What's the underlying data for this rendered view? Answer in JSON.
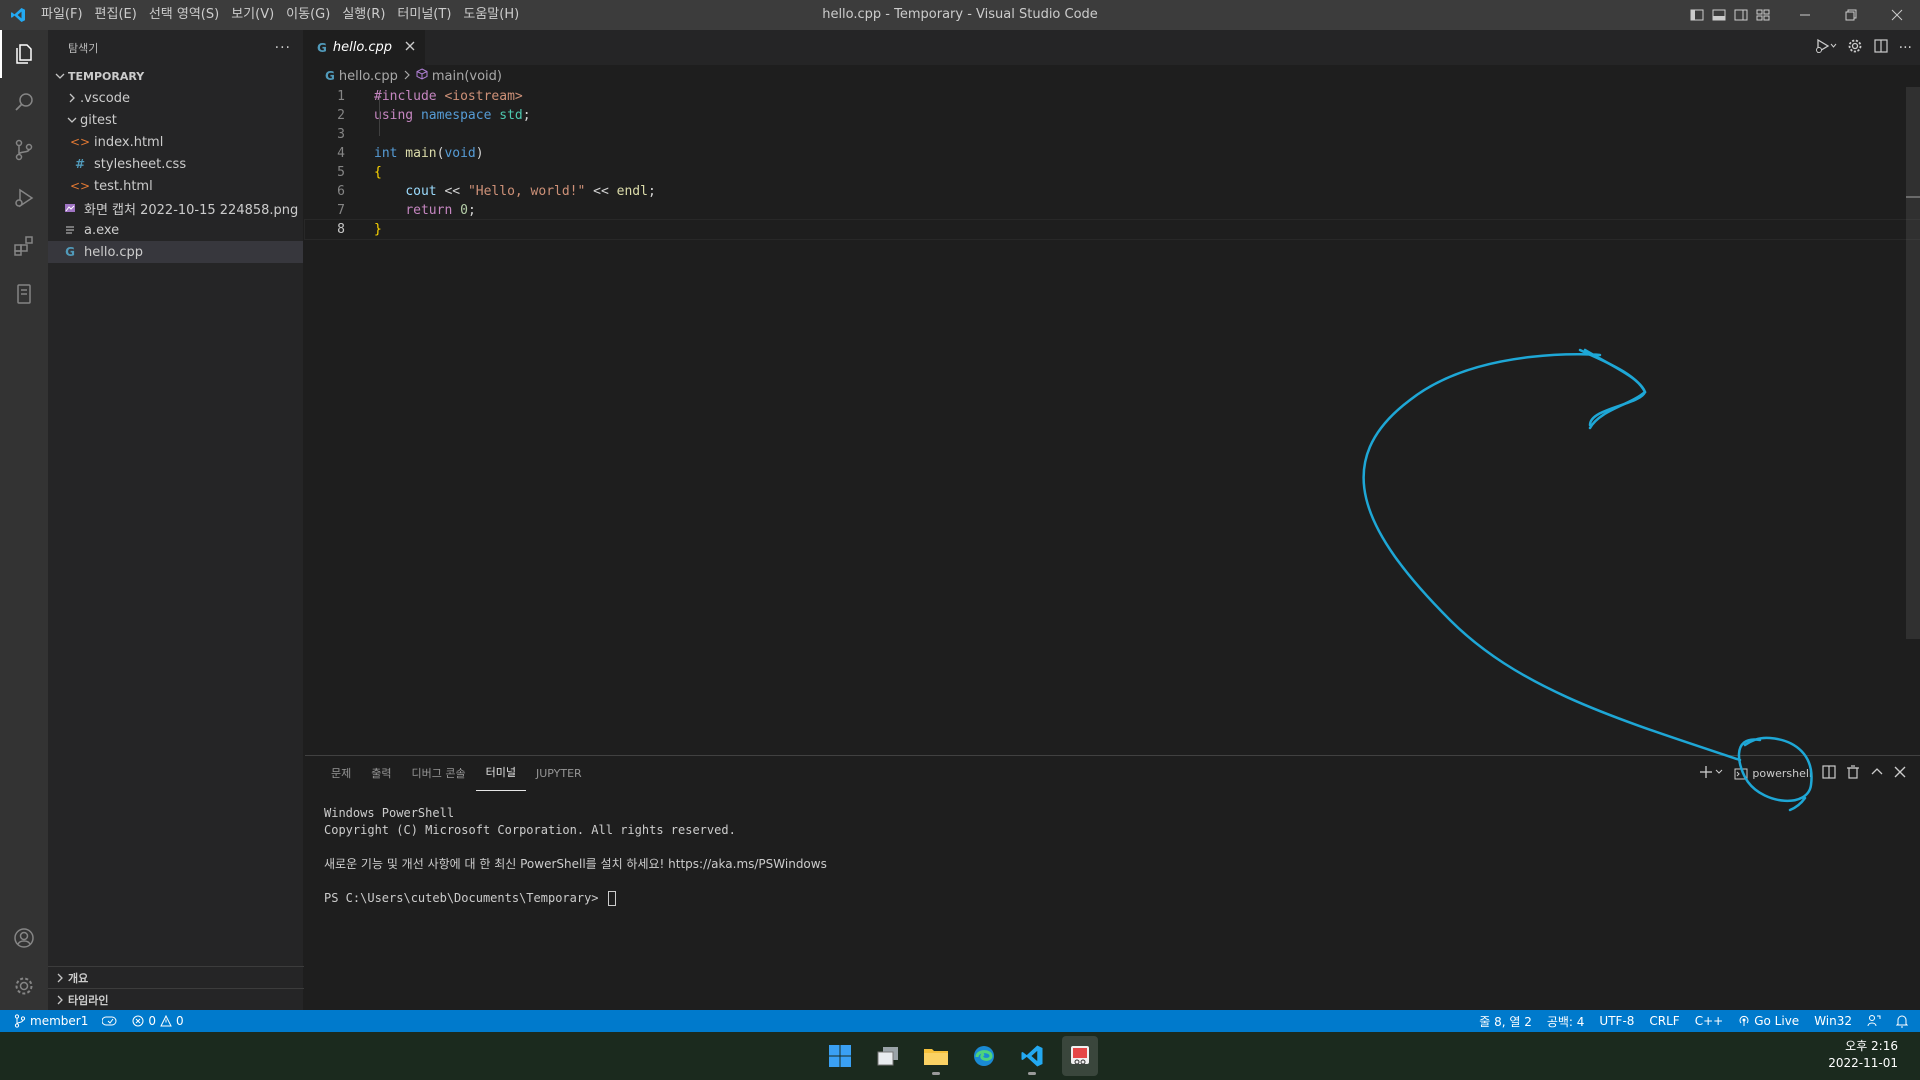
{
  "titlebar": {
    "title": "hello.cpp - Temporary - Visual Studio Code",
    "menu": [
      "파일(F)",
      "편집(E)",
      "선택 영역(S)",
      "보기(V)",
      "이동(G)",
      "실행(R)",
      "터미널(T)",
      "도움말(H)"
    ]
  },
  "sidebar": {
    "title": "탐색기",
    "more": "···",
    "folder": "TEMPORARY",
    "items": [
      {
        "label": ".vscode",
        "icon": "chevron-right-icon"
      },
      {
        "label": "gitest",
        "icon": "chevron-down-icon"
      },
      {
        "label": "index.html",
        "icon": "html-icon"
      },
      {
        "label": "stylesheet.css",
        "icon": "css-icon"
      },
      {
        "label": "test.html",
        "icon": "html-icon"
      },
      {
        "label": "화면 캡처 2022-10-15 224858.png",
        "icon": "image-icon"
      },
      {
        "label": "a.exe",
        "icon": "file-icon"
      },
      {
        "label": "hello.cpp",
        "icon": "cpp-icon"
      }
    ],
    "bottom_sections": [
      "개요",
      "타임라인"
    ]
  },
  "editor": {
    "tab_label": "hello.cpp",
    "breadcrumb": {
      "file": "hello.cpp",
      "symbol": "main(void)"
    },
    "line_numbers": [
      "1",
      "2",
      "3",
      "4",
      "5",
      "6",
      "7",
      "8"
    ],
    "code": {
      "l1_pre": "#include",
      "l1_inc": " <iostream>",
      "l2_using": "using",
      "l2_namespace": " namespace",
      "l2_std": " std",
      "l2_semi": ";",
      "l4_int": "int",
      "l4_main": " main",
      "l4_open": "(",
      "l4_void": "void",
      "l4_close": ")",
      "l5_brace": "{",
      "l6_indent": "    ",
      "l6_cout": "cout",
      "l6_op1": " << ",
      "l6_str": "\"Hello, world!\"",
      "l6_op2": " << ",
      "l6_endl": "endl",
      "l6_semi": ";",
      "l7_indent": "    ",
      "l7_return": "return",
      "l7_sp": " ",
      "l7_num": "0",
      "l7_semi": ";",
      "l8_brace": "}"
    }
  },
  "panel": {
    "tabs": [
      "문제",
      "출력",
      "디버그 콘솔",
      "터미널",
      "JUPYTER"
    ],
    "active_tab": "터미널",
    "shell_label": "powershell",
    "terminal": {
      "line1": "Windows PowerShell",
      "line2": "Copyright (C) Microsoft Corporation. All rights reserved.",
      "line3": "새로운 기능 및 개선 사항에 대 한 최신 PowerShell를 설치 하세요! https://aka.ms/PSWindows",
      "prompt": "PS C:\\Users\\cuteb\\Documents\\Temporary> "
    }
  },
  "statusbar": {
    "branch": "member1",
    "errors": "0",
    "warnings": "0",
    "position": "줄 8, 열 2",
    "spaces": "공백: 4",
    "encoding": "UTF-8",
    "eol": "CRLF",
    "language": "C++",
    "golive": "Go Live",
    "platform": "Win32"
  },
  "taskbar": {
    "time": "오후 2:16",
    "date": "2022-11-01"
  },
  "colors": {
    "accent": "#007acc",
    "annotation": "#1ea7d6"
  }
}
